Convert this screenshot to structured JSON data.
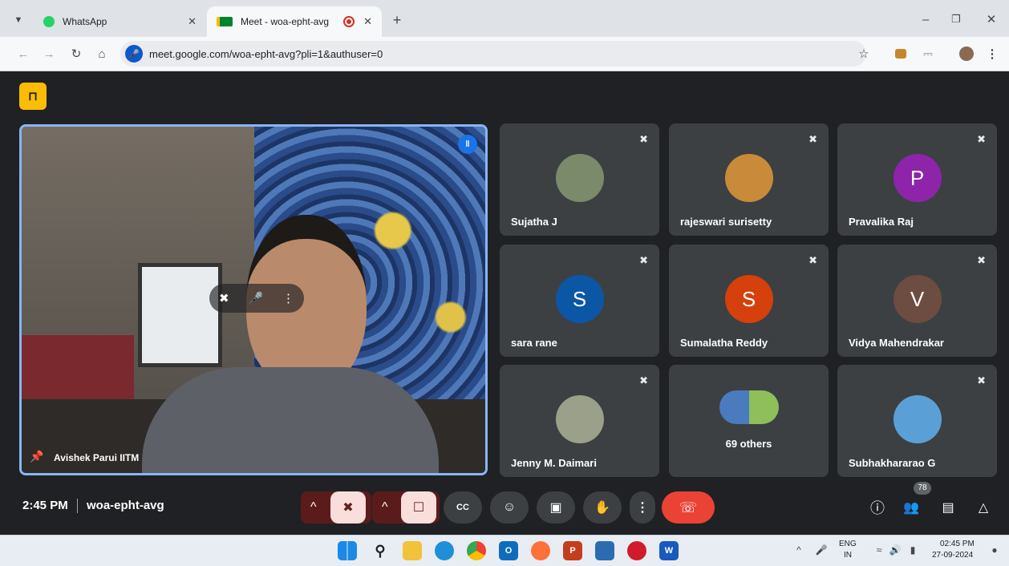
{
  "browser": {
    "tabs": [
      {
        "title": "WhatsApp",
        "active": false
      },
      {
        "title": "Meet - woa-epht-avg",
        "active": true
      }
    ],
    "url": "meet.google.com/woa-epht-avg?pli=1&authuser=0"
  },
  "meet": {
    "main_speaker": {
      "name": "Avishek Parui IITM"
    },
    "participants": [
      {
        "name": "Sujatha J",
        "initial": "",
        "color": "#7a8a6a"
      },
      {
        "name": "rajeswari surisetty",
        "initial": "",
        "color": "#c98a3a"
      },
      {
        "name": "Pravalika Raj",
        "initial": "P",
        "color": "#8e24aa"
      },
      {
        "name": "sara rane",
        "initial": "S",
        "color": "#0b57a6"
      },
      {
        "name": "Sumalatha Reddy",
        "initial": "S",
        "color": "#d5400c"
      },
      {
        "name": "Vidya Mahendrakar",
        "initial": "V",
        "color": "#6d4c41"
      },
      {
        "name": "Jenny M. Daimari",
        "initial": "",
        "color": "#9aa08a"
      },
      {
        "name": "69 others",
        "initial": "",
        "color": "#4a7bbf"
      },
      {
        "name": "Subhakhararao G",
        "initial": "",
        "color": "#5aa0d6"
      }
    ],
    "time": "2:45 PM",
    "meeting_code": "woa-epht-avg",
    "people_count": "78",
    "colors": {
      "end_call": "#ea4335",
      "muted": "#f9dedc",
      "active_border": "#8ab4f8"
    }
  },
  "taskbar": {
    "lang_top": "ENG",
    "lang_bottom": "IN",
    "clock_time": "02:45 PM",
    "clock_date": "27-09-2024"
  }
}
